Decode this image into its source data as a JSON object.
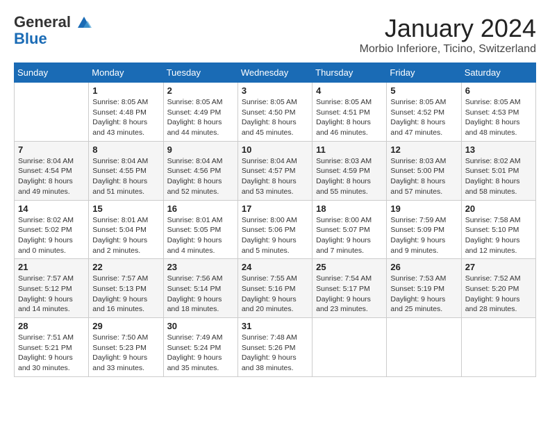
{
  "logo": {
    "general": "General",
    "blue": "Blue"
  },
  "title": {
    "month": "January 2024",
    "location": "Morbio Inferiore, Ticino, Switzerland"
  },
  "weekdays": [
    "Sunday",
    "Monday",
    "Tuesday",
    "Wednesday",
    "Thursday",
    "Friday",
    "Saturday"
  ],
  "weeks": [
    [
      {
        "day": "",
        "sunrise": "",
        "sunset": "",
        "daylight": ""
      },
      {
        "day": "1",
        "sunrise": "Sunrise: 8:05 AM",
        "sunset": "Sunset: 4:48 PM",
        "daylight": "Daylight: 8 hours and 43 minutes."
      },
      {
        "day": "2",
        "sunrise": "Sunrise: 8:05 AM",
        "sunset": "Sunset: 4:49 PM",
        "daylight": "Daylight: 8 hours and 44 minutes."
      },
      {
        "day": "3",
        "sunrise": "Sunrise: 8:05 AM",
        "sunset": "Sunset: 4:50 PM",
        "daylight": "Daylight: 8 hours and 45 minutes."
      },
      {
        "day": "4",
        "sunrise": "Sunrise: 8:05 AM",
        "sunset": "Sunset: 4:51 PM",
        "daylight": "Daylight: 8 hours and 46 minutes."
      },
      {
        "day": "5",
        "sunrise": "Sunrise: 8:05 AM",
        "sunset": "Sunset: 4:52 PM",
        "daylight": "Daylight: 8 hours and 47 minutes."
      },
      {
        "day": "6",
        "sunrise": "Sunrise: 8:05 AM",
        "sunset": "Sunset: 4:53 PM",
        "daylight": "Daylight: 8 hours and 48 minutes."
      }
    ],
    [
      {
        "day": "7",
        "sunrise": "Sunrise: 8:04 AM",
        "sunset": "Sunset: 4:54 PM",
        "daylight": "Daylight: 8 hours and 49 minutes."
      },
      {
        "day": "8",
        "sunrise": "Sunrise: 8:04 AM",
        "sunset": "Sunset: 4:55 PM",
        "daylight": "Daylight: 8 hours and 51 minutes."
      },
      {
        "day": "9",
        "sunrise": "Sunrise: 8:04 AM",
        "sunset": "Sunset: 4:56 PM",
        "daylight": "Daylight: 8 hours and 52 minutes."
      },
      {
        "day": "10",
        "sunrise": "Sunrise: 8:04 AM",
        "sunset": "Sunset: 4:57 PM",
        "daylight": "Daylight: 8 hours and 53 minutes."
      },
      {
        "day": "11",
        "sunrise": "Sunrise: 8:03 AM",
        "sunset": "Sunset: 4:59 PM",
        "daylight": "Daylight: 8 hours and 55 minutes."
      },
      {
        "day": "12",
        "sunrise": "Sunrise: 8:03 AM",
        "sunset": "Sunset: 5:00 PM",
        "daylight": "Daylight: 8 hours and 57 minutes."
      },
      {
        "day": "13",
        "sunrise": "Sunrise: 8:02 AM",
        "sunset": "Sunset: 5:01 PM",
        "daylight": "Daylight: 8 hours and 58 minutes."
      }
    ],
    [
      {
        "day": "14",
        "sunrise": "Sunrise: 8:02 AM",
        "sunset": "Sunset: 5:02 PM",
        "daylight": "Daylight: 9 hours and 0 minutes."
      },
      {
        "day": "15",
        "sunrise": "Sunrise: 8:01 AM",
        "sunset": "Sunset: 5:04 PM",
        "daylight": "Daylight: 9 hours and 2 minutes."
      },
      {
        "day": "16",
        "sunrise": "Sunrise: 8:01 AM",
        "sunset": "Sunset: 5:05 PM",
        "daylight": "Daylight: 9 hours and 4 minutes."
      },
      {
        "day": "17",
        "sunrise": "Sunrise: 8:00 AM",
        "sunset": "Sunset: 5:06 PM",
        "daylight": "Daylight: 9 hours and 5 minutes."
      },
      {
        "day": "18",
        "sunrise": "Sunrise: 8:00 AM",
        "sunset": "Sunset: 5:07 PM",
        "daylight": "Daylight: 9 hours and 7 minutes."
      },
      {
        "day": "19",
        "sunrise": "Sunrise: 7:59 AM",
        "sunset": "Sunset: 5:09 PM",
        "daylight": "Daylight: 9 hours and 9 minutes."
      },
      {
        "day": "20",
        "sunrise": "Sunrise: 7:58 AM",
        "sunset": "Sunset: 5:10 PM",
        "daylight": "Daylight: 9 hours and 12 minutes."
      }
    ],
    [
      {
        "day": "21",
        "sunrise": "Sunrise: 7:57 AM",
        "sunset": "Sunset: 5:12 PM",
        "daylight": "Daylight: 9 hours and 14 minutes."
      },
      {
        "day": "22",
        "sunrise": "Sunrise: 7:57 AM",
        "sunset": "Sunset: 5:13 PM",
        "daylight": "Daylight: 9 hours and 16 minutes."
      },
      {
        "day": "23",
        "sunrise": "Sunrise: 7:56 AM",
        "sunset": "Sunset: 5:14 PM",
        "daylight": "Daylight: 9 hours and 18 minutes."
      },
      {
        "day": "24",
        "sunrise": "Sunrise: 7:55 AM",
        "sunset": "Sunset: 5:16 PM",
        "daylight": "Daylight: 9 hours and 20 minutes."
      },
      {
        "day": "25",
        "sunrise": "Sunrise: 7:54 AM",
        "sunset": "Sunset: 5:17 PM",
        "daylight": "Daylight: 9 hours and 23 minutes."
      },
      {
        "day": "26",
        "sunrise": "Sunrise: 7:53 AM",
        "sunset": "Sunset: 5:19 PM",
        "daylight": "Daylight: 9 hours and 25 minutes."
      },
      {
        "day": "27",
        "sunrise": "Sunrise: 7:52 AM",
        "sunset": "Sunset: 5:20 PM",
        "daylight": "Daylight: 9 hours and 28 minutes."
      }
    ],
    [
      {
        "day": "28",
        "sunrise": "Sunrise: 7:51 AM",
        "sunset": "Sunset: 5:21 PM",
        "daylight": "Daylight: 9 hours and 30 minutes."
      },
      {
        "day": "29",
        "sunrise": "Sunrise: 7:50 AM",
        "sunset": "Sunset: 5:23 PM",
        "daylight": "Daylight: 9 hours and 33 minutes."
      },
      {
        "day": "30",
        "sunrise": "Sunrise: 7:49 AM",
        "sunset": "Sunset: 5:24 PM",
        "daylight": "Daylight: 9 hours and 35 minutes."
      },
      {
        "day": "31",
        "sunrise": "Sunrise: 7:48 AM",
        "sunset": "Sunset: 5:26 PM",
        "daylight": "Daylight: 9 hours and 38 minutes."
      },
      {
        "day": "",
        "sunrise": "",
        "sunset": "",
        "daylight": ""
      },
      {
        "day": "",
        "sunrise": "",
        "sunset": "",
        "daylight": ""
      },
      {
        "day": "",
        "sunrise": "",
        "sunset": "",
        "daylight": ""
      }
    ]
  ]
}
